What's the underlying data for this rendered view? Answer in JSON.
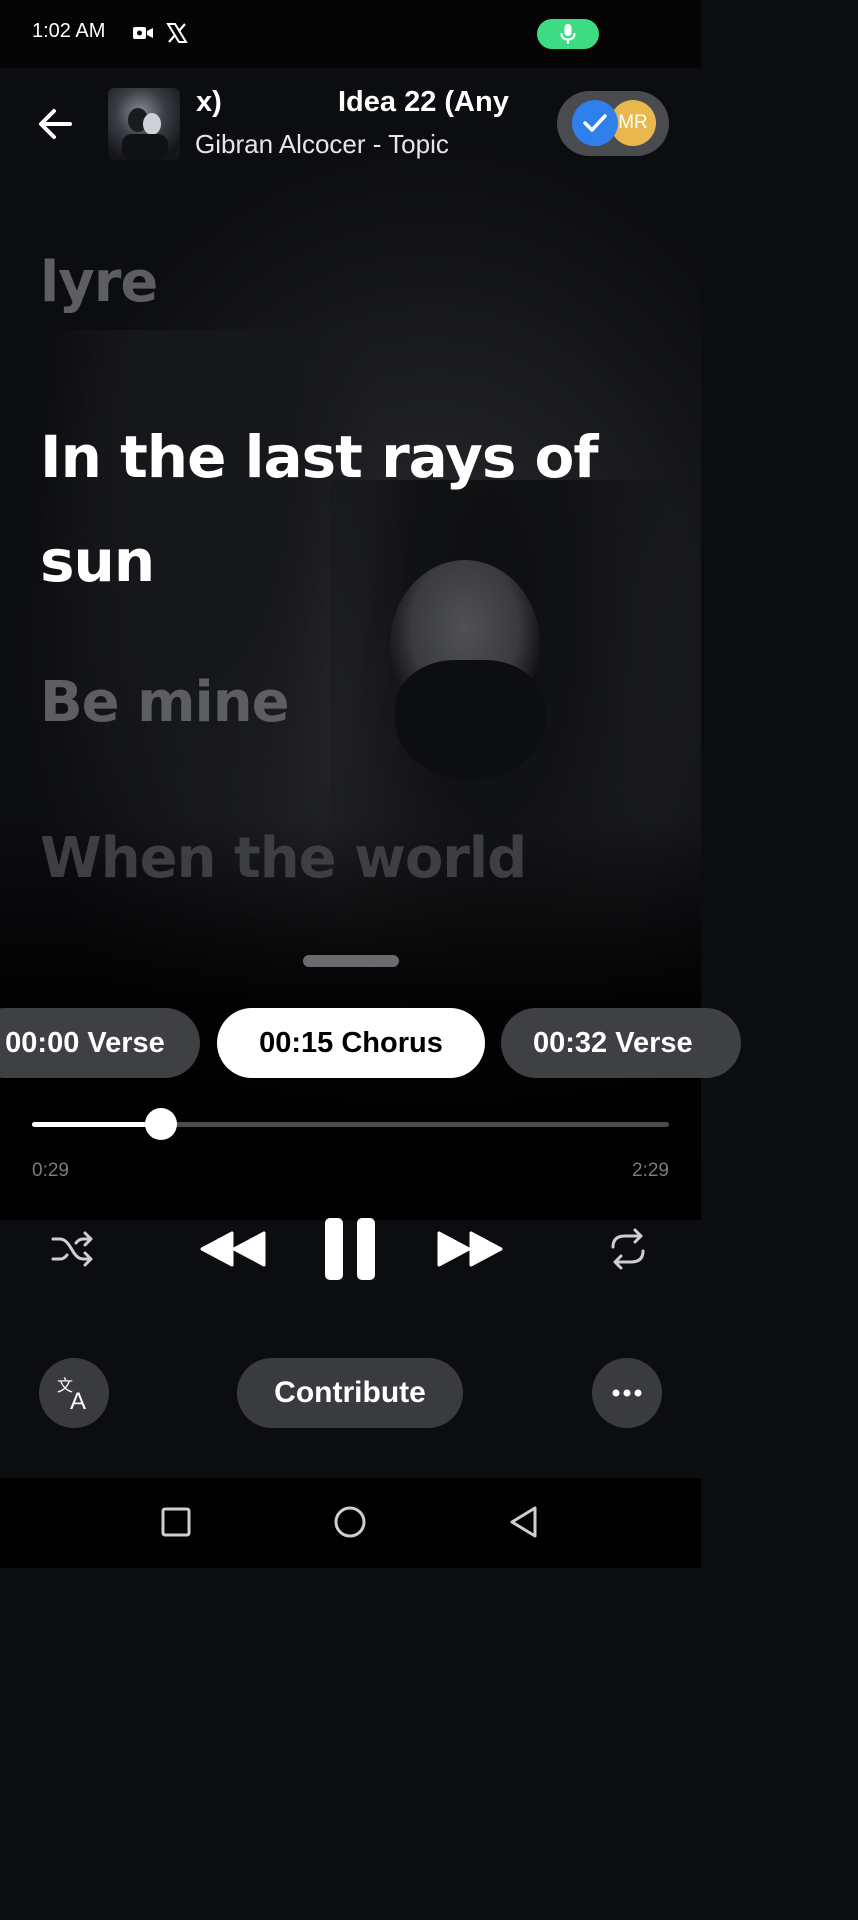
{
  "status_bar": {
    "time": "1:02 AM",
    "icons": [
      "video-camera-icon",
      "x-logo-icon",
      "microphone-icon"
    ],
    "mic_indicator_color": "#3ddc84"
  },
  "header": {
    "title_fragment": "x)",
    "title_scrolling": "Idea 22 (Any",
    "artist": "Gibran Alcocer - Topic",
    "avatar_initials": "MR",
    "back_icon": "arrow-left-icon",
    "check_icon": "checkmark-icon"
  },
  "lyrics": {
    "previous": "lyre",
    "current": "In the last rays of sun",
    "next": "Be mine",
    "upcoming": "When the world"
  },
  "sections": [
    {
      "label": "00:00 Verse",
      "active": false
    },
    {
      "label": "00:15 Chorus",
      "active": true
    },
    {
      "label": "00:32 Verse",
      "active": false
    }
  ],
  "progress": {
    "elapsed": "0:29",
    "total": "2:29",
    "fraction": 0.202
  },
  "controls": {
    "shuffle_icon": "shuffle-icon",
    "previous_icon": "rewind-icon",
    "play_state_icon": "pause-icon",
    "next_icon": "fast-forward-icon",
    "repeat_icon": "repeat-icon"
  },
  "bottom_actions": {
    "translate_icon": "translate-icon",
    "contribute_label": "Contribute",
    "more_icon": "more-horizontal-icon"
  },
  "nav_bar": {
    "recents_icon": "square-icon",
    "home_icon": "circle-icon",
    "back_icon": "triangle-back-icon"
  },
  "colors": {
    "accent_active_chip": "#ffffff",
    "chip_inactive": "#3f4043",
    "avatar_check": "#2f80ed",
    "avatar_mr": "#e8b84e"
  }
}
